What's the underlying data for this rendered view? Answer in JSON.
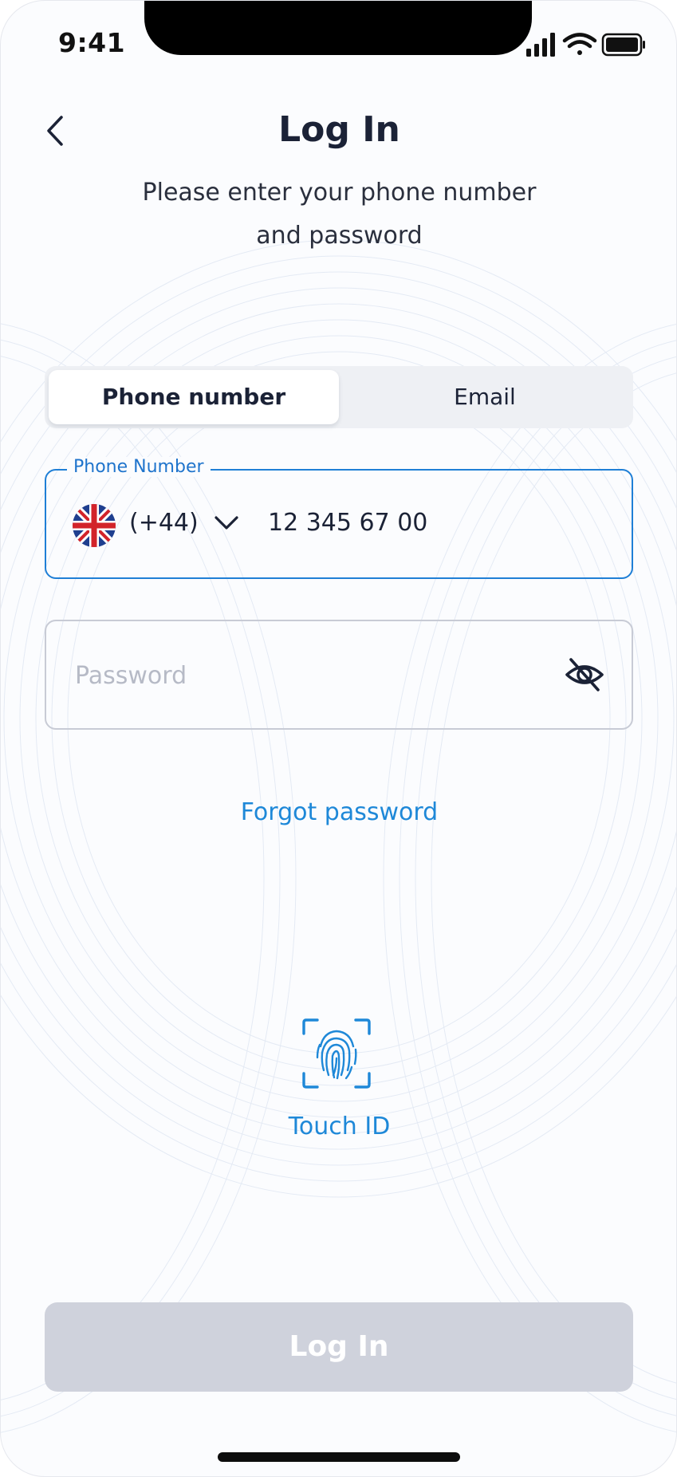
{
  "status_bar": {
    "time": "9:41"
  },
  "header": {
    "title": "Log In",
    "subtitle_line1": "Please enter your phone number",
    "subtitle_line2": "and password"
  },
  "tabs": [
    {
      "label": "Phone number",
      "active": true
    },
    {
      "label": "Email",
      "active": false
    }
  ],
  "phone_field": {
    "label": "Phone Number",
    "country_code": "(+44)",
    "value": "12 345 67 00",
    "flag": "uk-flag-icon"
  },
  "password_field": {
    "placeholder": "Password",
    "value": ""
  },
  "forgot_password": "Forgot password",
  "touch_id": {
    "label": "Touch ID",
    "icon": "fingerprint-icon"
  },
  "login_button": {
    "label": "Log In",
    "enabled": false
  },
  "colors": {
    "accent": "#1e88d8",
    "focus_border": "#1f7fd6",
    "title": "#1b2236",
    "button_disabled": "#cfd2dc",
    "tab_bg": "#eef0f4"
  }
}
